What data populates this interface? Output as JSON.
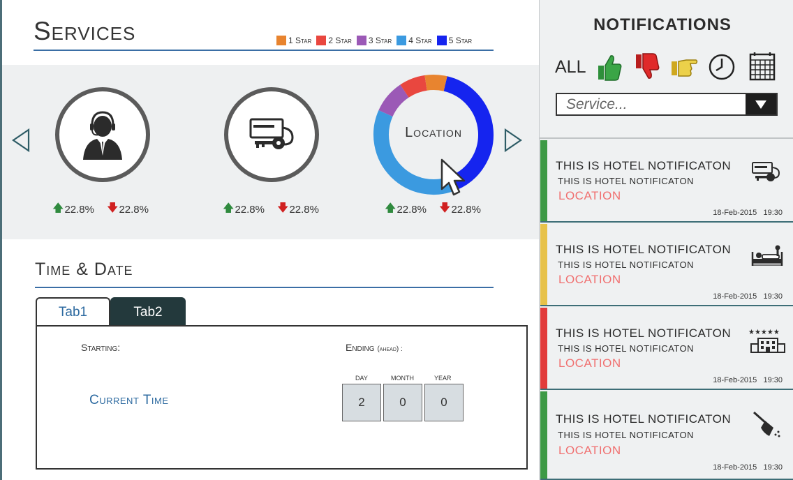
{
  "services": {
    "title": "Services",
    "legend": [
      {
        "label": "1 Star",
        "color": "#e8842f"
      },
      {
        "label": "2 Star",
        "color": "#e9473f"
      },
      {
        "label": "3 Star",
        "color": "#9b59b6"
      },
      {
        "label": "4 Star",
        "color": "#3b9ae0"
      },
      {
        "label": "5 Star",
        "color": "#1524ef"
      }
    ],
    "items": [
      {
        "name": "reception",
        "up": "22.8%",
        "down": "22.8%"
      },
      {
        "name": "keycard",
        "up": "22.8%",
        "down": "22.8%"
      },
      {
        "name": "location",
        "label": "Location",
        "up": "22.8%",
        "down": "22.8%",
        "shares": [
          {
            "star": "5 Star",
            "value": 40,
            "color": "#1524ef"
          },
          {
            "star": "4 Star",
            "value": 38,
            "color": "#3b9ae0"
          },
          {
            "star": "3 Star",
            "value": 9,
            "color": "#9b59b6"
          },
          {
            "star": "2 Star",
            "value": 7,
            "color": "#e9473f"
          },
          {
            "star": "1 Star",
            "value": 6,
            "color": "#e8842f"
          }
        ]
      }
    ]
  },
  "time_date": {
    "title": "Time & Date",
    "tabs": [
      "Tab1",
      "Tab2"
    ],
    "active_tab": "Tab2",
    "starting_label": "Starting:",
    "ending_label": "Ending",
    "ending_sub": "(ahead) :",
    "current_time": "Current Time",
    "fields": [
      {
        "caption": "DAY",
        "value": "2"
      },
      {
        "caption": "MONTH",
        "value": "0"
      },
      {
        "caption": "YEAR",
        "value": "0"
      }
    ]
  },
  "notifications": {
    "title": "NOTIFICATIONS",
    "filter_all": "ALL",
    "dropdown_placeholder": "Service...",
    "cards": [
      {
        "title": "THIS IS HOTEL NOTIFICATON",
        "subtitle": "THIS IS HOTEL NOTIFICATON",
        "location": "LOCATION",
        "date": "18-Feb-2015",
        "time": "19:30",
        "status_color": "#3d9a45",
        "icon": "keycard-icon"
      },
      {
        "title": "THIS IS HOTEL NOTIFICATON",
        "subtitle": "THIS IS HOTEL NOTIFICATON",
        "location": "LOCATION",
        "date": "18-Feb-2015",
        "time": "19:30",
        "status_color": "#e7c24a",
        "icon": "bed-icon"
      },
      {
        "title": "THIS IS HOTEL NOTIFICATON",
        "subtitle": "THIS IS HOTEL NOTIFICATON",
        "location": "LOCATION",
        "date": "18-Feb-2015",
        "time": "19:30",
        "status_color": "#e23b3b",
        "icon": "hotel-stars-icon"
      },
      {
        "title": "THIS IS HOTEL NOTIFICATON",
        "subtitle": "THIS IS HOTEL NOTIFICATON",
        "location": "LOCATION",
        "date": "18-Feb-2015",
        "time": "19:30",
        "status_color": "#3d9a45",
        "icon": "broom-icon"
      }
    ]
  }
}
